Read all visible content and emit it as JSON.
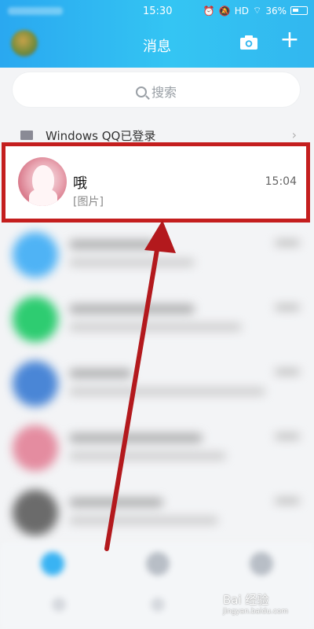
{
  "status_bar": {
    "time": "15:30",
    "right_text": "HD",
    "battery": "36%"
  },
  "header": {
    "title": "消息"
  },
  "search": {
    "placeholder": "搜索"
  },
  "login_notice": {
    "text": "Windows QQ已登录",
    "chevron": "›"
  },
  "highlighted_chat": {
    "name": "哦",
    "preview": "[图片]",
    "time": "15:04"
  },
  "watermark": {
    "text": "Bai 经验",
    "sub": "jingyan.baidu.com"
  },
  "colors": {
    "header": "#2aa8f0",
    "highlight_border": "#c41e1e",
    "arrow": "#b3191d"
  },
  "icons": [
    "camera-icon",
    "plus-icon",
    "search-icon",
    "computer-icon",
    "chevron-right-icon",
    "alarm-icon",
    "mute-icon",
    "wifi-icon",
    "battery-icon"
  ]
}
